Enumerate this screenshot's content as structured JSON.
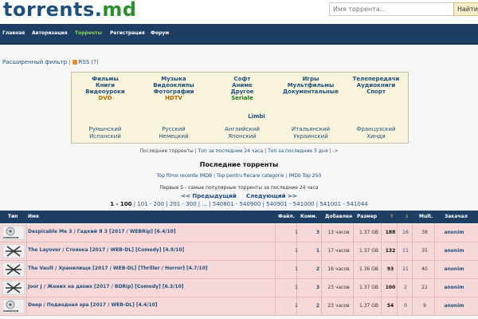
{
  "header": {
    "logo_main": "torrents.",
    "logo_suffix": "md",
    "search_placeholder": "Имя торрента...",
    "search_button": "Найти"
  },
  "nav": {
    "items": [
      {
        "label": "Главная",
        "active": false
      },
      {
        "label": "Авторизация",
        "active": false
      },
      {
        "label": "Торренты",
        "active": true
      },
      {
        "label": "Регистрация",
        "active": false
      },
      {
        "label": "Форум",
        "active": false
      }
    ]
  },
  "filter": {
    "advanced": "Расширенный фильтр",
    "rss": "RSS (?)"
  },
  "categories": {
    "col1": [
      "Фильмы",
      "Книги",
      "Видеоуроки",
      "DVD"
    ],
    "col2": [
      "Музыка",
      "Видеоклипы",
      "Фотографии",
      "HDTV"
    ],
    "col3": [
      "Софт",
      "Аниме",
      "Другое",
      "Seriale"
    ],
    "col4": [
      "Игры",
      "Мультфильмы",
      "Документальные"
    ],
    "col5": [
      "Телепередачи",
      "Аудиокниги",
      "Спорт"
    ],
    "limbi": "Limbi",
    "lang1": [
      "Румынский",
      "Испанский"
    ],
    "lang2": [
      "Русский",
      "Немецкий"
    ],
    "lang3": [
      "Английский",
      "Японский"
    ],
    "lang4": [
      "Итальянский",
      "Украинский"
    ],
    "lang5": [
      "Французский",
      "Хинди"
    ]
  },
  "links": {
    "recent": "Последние торренты",
    "top24": "Топ за последние 24 часа",
    "top3d": "Топ за последние 3 дня",
    "arrow": "->"
  },
  "section_title": "Последние торренты",
  "top_links": {
    "imdb": "Top filme recente IMDB",
    "parents": "Top pentru fiecare categorie",
    "imdb250": "IMDb Top 250"
  },
  "first5": "Первые 5 - самые популярные торренты за последние 24 часа",
  "pager": {
    "prev": "<< Предыдущий",
    "next": "Следующий >>",
    "pages": [
      "1 - 100",
      "101 - 200",
      "201 - 300",
      "...",
      "540801 - 540900",
      "540901 - 541000",
      "541001 - 541044"
    ]
  },
  "table": {
    "headers": [
      "Тип",
      "Имя",
      "Файл.",
      "Комм.",
      "Добавлен",
      "Размер",
      "⇑",
      "⇓",
      "Mult.",
      "Закачал"
    ],
    "rows": [
      {
        "type": "ANIMATION",
        "name": "Despicable Me 3 / Гадкий Я 3 [2017 / WEBRip] [6.4/10]",
        "files": "1",
        "comments": "3",
        "added": "13 часов",
        "size": "1.37 GB",
        "seed": "188",
        "leech": "16",
        "mult": "38",
        "uploader": "anonim"
      },
      {
        "type": "FILM",
        "name": "The Layover / Стоянка [2017 / WEB-DL] [Comedy] [4.9/10]",
        "files": "1",
        "comments": "1",
        "added": "17 часов",
        "size": "1.37 GB",
        "seed": "132",
        "leech": "11",
        "mult": "35",
        "uploader": "anonim"
      },
      {
        "type": "FILM",
        "name": "The Vault / Хранилище [2017 / WEB-DL] [Thriller / Horror] [4.7/10]",
        "files": "1",
        "comments": "2",
        "added": "16 часов",
        "size": "1.36 GB",
        "seed": "93",
        "leech": "11",
        "mult": "40",
        "uploader": "anonim"
      },
      {
        "type": "FILM",
        "name": "Joor J / Жених на двоих [2017 / BDRip] [Comedy] [6.3/10]",
        "files": "1",
        "comments": "3",
        "added": "23 часов",
        "size": "1.37 GB",
        "seed": "100",
        "leech": "2",
        "mult": "22",
        "uploader": "anonim"
      },
      {
        "type": "ANIMATION",
        "name": "Deep / Подводная эра [2017 / WEB-DL] [4.4/10]",
        "files": "1",
        "comments": "2",
        "added": "23 часов",
        "size": "1.37 GB",
        "seed": "54",
        "leech": "0",
        "mult": "9",
        "uploader": "anonim"
      }
    ]
  },
  "colors": {
    "nav_bg": "#1e3f63",
    "row_bg": "#f6d8d8",
    "link": "#1f4f7d",
    "active_nav": "#8fd35a"
  }
}
